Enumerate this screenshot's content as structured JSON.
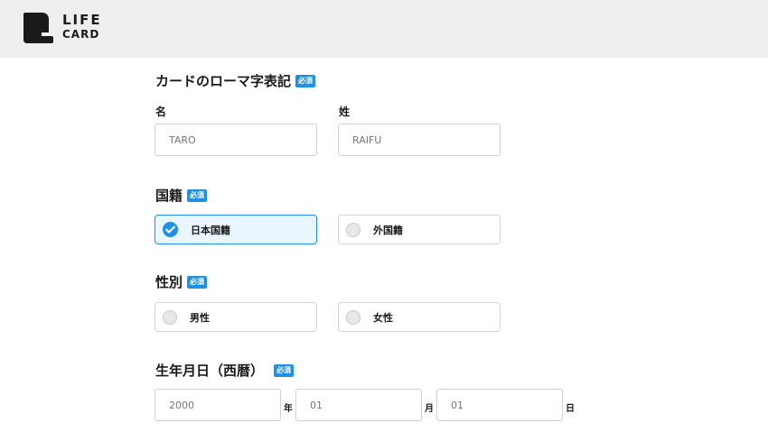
{
  "header": {
    "logo_line1": "LIFE",
    "logo_line2": "CARD",
    "logo_icon": "life-card-logo-mark"
  },
  "required_badge": "必須",
  "romaji": {
    "title": "カードのローマ字表記",
    "first_name_label": "名",
    "last_name_label": "姓",
    "first_name_placeholder": "TARO",
    "last_name_placeholder": "RAIFU"
  },
  "nationality": {
    "title": "国籍",
    "options": [
      {
        "label": "日本国籍",
        "selected": true
      },
      {
        "label": "外国籍",
        "selected": false
      }
    ]
  },
  "gender": {
    "title": "性別",
    "options": [
      {
        "label": "男性",
        "selected": false
      },
      {
        "label": "女性",
        "selected": false
      }
    ]
  },
  "birthdate": {
    "title": "生年月日（西暦）",
    "year_placeholder": "2000",
    "year_unit": "年",
    "month_placeholder": "01",
    "month_unit": "月",
    "day_placeholder": "01",
    "day_unit": "日"
  },
  "colors": {
    "accent": "#1e90e6",
    "header_bg": "#efefef",
    "selected_bg": "#e9f6fd"
  }
}
